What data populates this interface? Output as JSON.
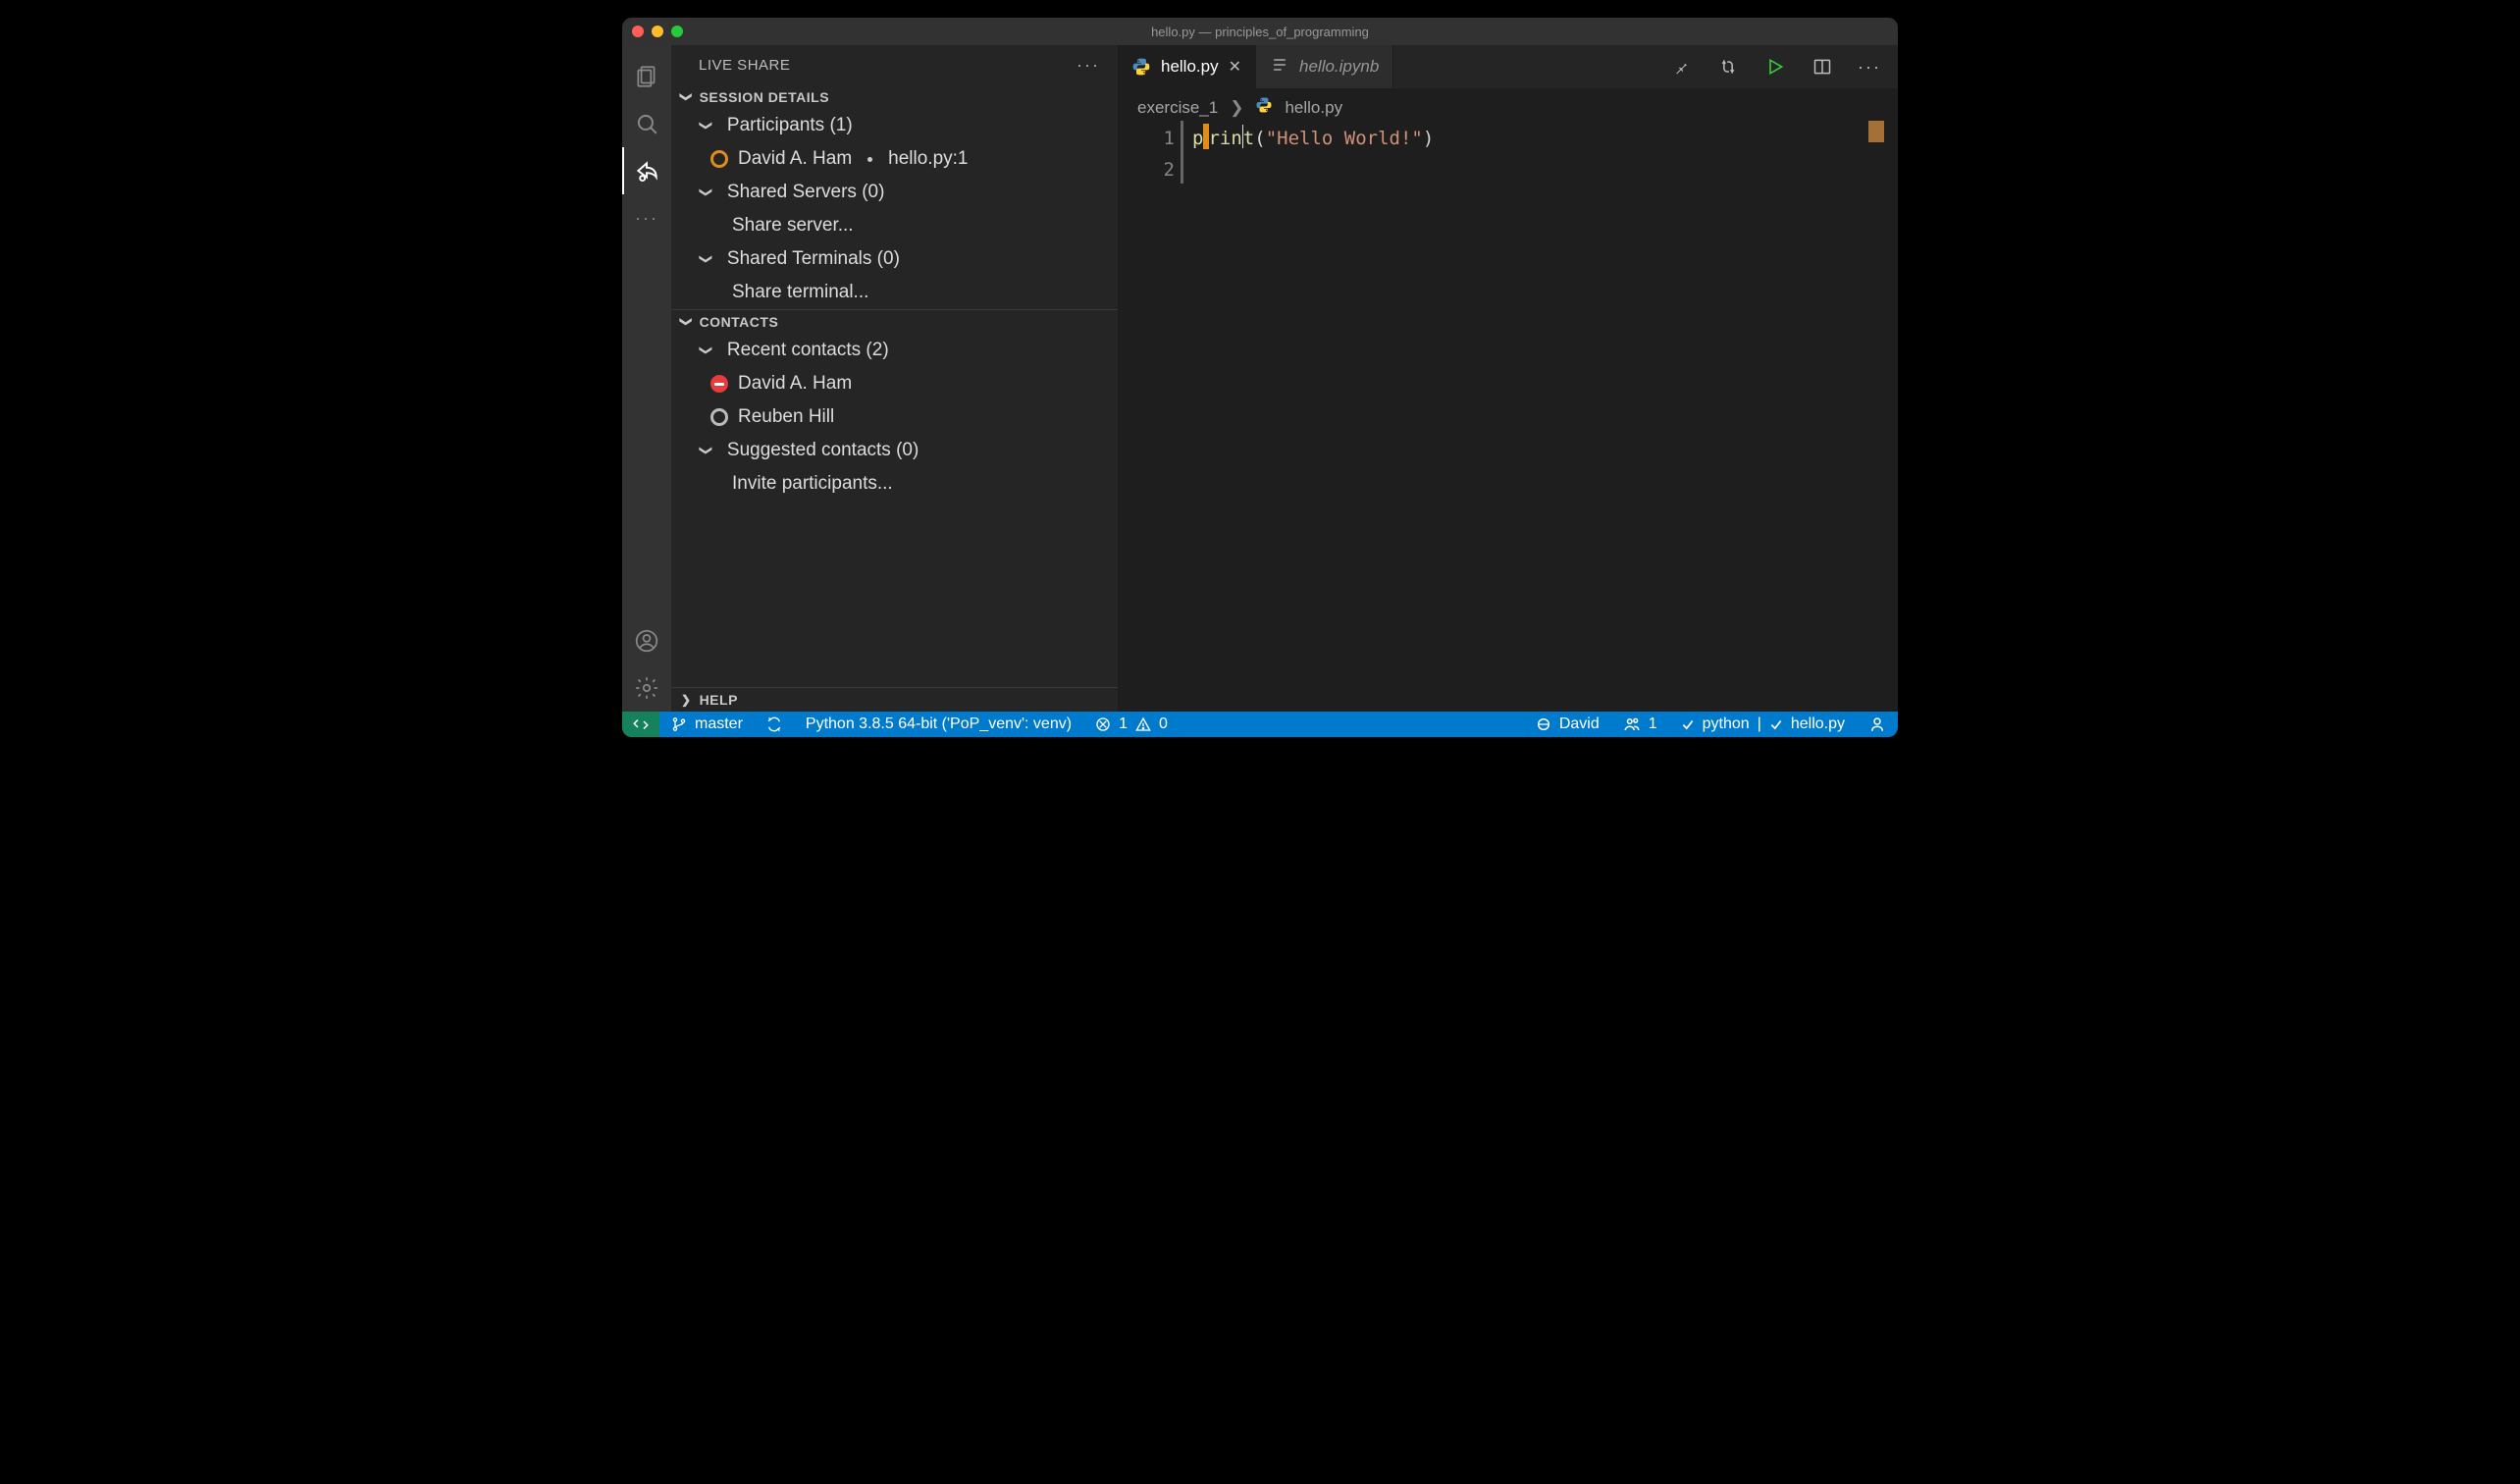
{
  "window": {
    "title": "hello.py — principles_of_programming"
  },
  "sidebar": {
    "title": "LIVE SHARE",
    "sections": {
      "session": {
        "label": "SESSION DETAILS",
        "participants_label": "Participants (1)",
        "participant_name": "David A. Ham",
        "participant_loc": "hello.py:1",
        "shared_servers_label": "Shared Servers (0)",
        "share_server": "Share server...",
        "shared_terminals_label": "Shared Terminals (0)",
        "share_terminal": "Share terminal..."
      },
      "contacts": {
        "label": "CONTACTS",
        "recent_label": "Recent contacts (2)",
        "recent": [
          "David A. Ham",
          "Reuben Hill"
        ],
        "suggested_label": "Suggested contacts (0)",
        "invite": "Invite participants..."
      },
      "help": {
        "label": "HELP"
      }
    }
  },
  "tabs": {
    "active": "hello.py",
    "inactive": "hello.ipynb"
  },
  "breadcrumb": {
    "folder": "exercise_1",
    "file": "hello.py"
  },
  "code": {
    "line_numbers": [
      "1",
      "2"
    ],
    "line1_fn": "print",
    "line1_open": "(",
    "line1_str": "\"Hello World!\"",
    "line1_close": ")"
  },
  "status": {
    "branch": "master",
    "python": "Python 3.8.5 64-bit ('PoP_venv': venv)",
    "errors": "1",
    "warnings": "0",
    "liveshare_user": "David",
    "participants_count": "1",
    "lang": "python",
    "file": "hello.py"
  }
}
